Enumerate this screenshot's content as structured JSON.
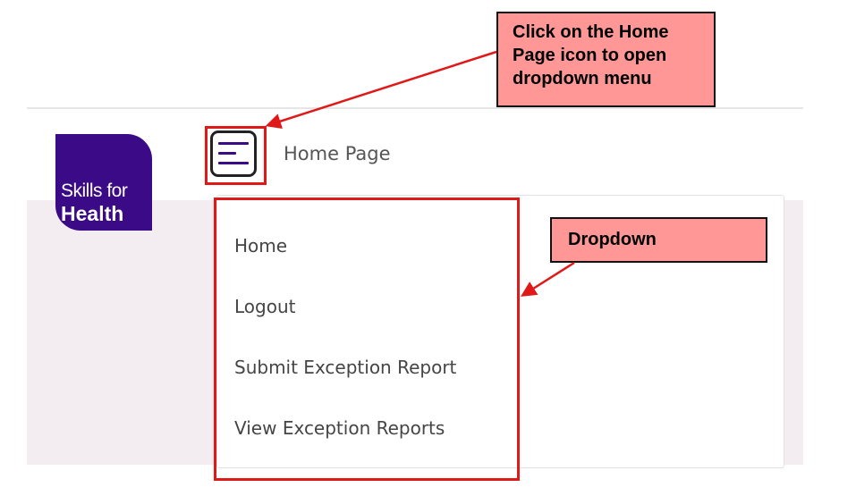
{
  "header": {
    "logo": {
      "line1": "Skills for",
      "line2": "Health"
    },
    "menu_icon": "hamburger-menu-icon",
    "page_title": "Home Page"
  },
  "dropdown": {
    "items": [
      {
        "label": "Home"
      },
      {
        "label": "Logout"
      },
      {
        "label": "Submit Exception Report"
      },
      {
        "label": "View Exception Reports"
      }
    ]
  },
  "annotations": {
    "callout_icon": "Click on the Home Page icon to open dropdown menu",
    "callout_dropdown": "Dropdown",
    "highlight_color": "#e01818",
    "callout_color": "#ff9797"
  },
  "colors": {
    "brand": "#3b0a86",
    "content_bg": "#f3edf1"
  }
}
